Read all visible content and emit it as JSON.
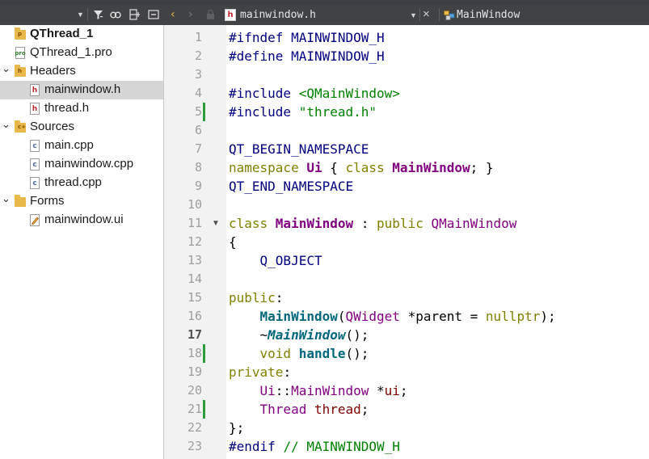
{
  "editor": {
    "file_badge": "h",
    "filename": "mainwindow.h",
    "symbol": "MainWindow",
    "nav_back": "‹",
    "nav_forward": "›",
    "close_glyph": "×",
    "lines": [
      {
        "n": "1",
        "mod": false,
        "fold": false,
        "tokens": [
          [
            "pp",
            "#ifndef MAINWINDOW_H"
          ]
        ]
      },
      {
        "n": "2",
        "mod": false,
        "fold": false,
        "tokens": [
          [
            "pp",
            "#define MAINWINDOW_H"
          ]
        ]
      },
      {
        "n": "3",
        "mod": false,
        "fold": false,
        "tokens": []
      },
      {
        "n": "4",
        "mod": false,
        "fold": false,
        "tokens": [
          [
            "pp",
            "#include "
          ],
          [
            "str",
            "<QMainWindow>"
          ]
        ]
      },
      {
        "n": "5",
        "mod": true,
        "fold": false,
        "tokens": [
          [
            "pp",
            "#include "
          ],
          [
            "str",
            "\"thread.h\""
          ]
        ]
      },
      {
        "n": "6",
        "mod": false,
        "fold": false,
        "tokens": []
      },
      {
        "n": "7",
        "mod": false,
        "fold": false,
        "tokens": [
          [
            "mac",
            "QT_BEGIN_NAMESPACE"
          ]
        ]
      },
      {
        "n": "8",
        "mod": false,
        "fold": false,
        "tokens": [
          [
            "kw",
            "namespace "
          ],
          [
            "ty",
            "Ui"
          ],
          [
            "",
            " { "
          ],
          [
            "kw",
            "class "
          ],
          [
            "ty",
            "MainWindow"
          ],
          [
            "",
            "; }"
          ]
        ]
      },
      {
        "n": "9",
        "mod": false,
        "fold": false,
        "tokens": [
          [
            "mac",
            "QT_END_NAMESPACE"
          ]
        ]
      },
      {
        "n": "10",
        "mod": false,
        "fold": false,
        "tokens": []
      },
      {
        "n": "11",
        "mod": false,
        "fold": true,
        "tokens": [
          [
            "kw",
            "class "
          ],
          [
            "ty",
            "MainWindow"
          ],
          [
            "",
            " : "
          ],
          [
            "kw",
            "public "
          ],
          [
            "ty2",
            "QMainWindow"
          ]
        ]
      },
      {
        "n": "12",
        "mod": false,
        "fold": false,
        "tokens": [
          [
            "",
            "{"
          ]
        ]
      },
      {
        "n": "13",
        "mod": false,
        "fold": false,
        "tokens": [
          [
            "",
            "    "
          ],
          [
            "mac",
            "Q_OBJECT"
          ]
        ]
      },
      {
        "n": "14",
        "mod": false,
        "fold": false,
        "tokens": []
      },
      {
        "n": "15",
        "mod": false,
        "fold": false,
        "tokens": [
          [
            "kw",
            "public"
          ],
          [
            "",
            ":"
          ]
        ]
      },
      {
        "n": "16",
        "mod": false,
        "fold": false,
        "tokens": [
          [
            "",
            "    "
          ],
          [
            "fn",
            "MainWindow"
          ],
          [
            "",
            "("
          ],
          [
            "ty2",
            "QWidget"
          ],
          [
            "",
            " *parent = "
          ],
          [
            "kw",
            "nullptr"
          ],
          [
            "",
            ");"
          ]
        ]
      },
      {
        "n": "17",
        "mod": false,
        "fold": false,
        "cur": true,
        "tokens": [
          [
            "",
            "    ~"
          ],
          [
            "fni",
            "MainWindow"
          ],
          [
            "",
            "();"
          ]
        ]
      },
      {
        "n": "18",
        "mod": true,
        "fold": false,
        "tokens": [
          [
            "",
            "    "
          ],
          [
            "kw",
            "void "
          ],
          [
            "fn",
            "handle"
          ],
          [
            "",
            "();"
          ]
        ]
      },
      {
        "n": "19",
        "mod": false,
        "fold": false,
        "tokens": [
          [
            "kw",
            "private"
          ],
          [
            "",
            ":"
          ]
        ]
      },
      {
        "n": "20",
        "mod": false,
        "fold": false,
        "tokens": [
          [
            "",
            "    "
          ],
          [
            "ty2",
            "Ui"
          ],
          [
            "",
            "::"
          ],
          [
            "ty2",
            "MainWindow"
          ],
          [
            "",
            " *"
          ],
          [
            "mem",
            "ui"
          ],
          [
            "",
            ";"
          ]
        ]
      },
      {
        "n": "21",
        "mod": true,
        "fold": false,
        "tokens": [
          [
            "",
            "    "
          ],
          [
            "ty2",
            "Thread "
          ],
          [
            "mem",
            "thread"
          ],
          [
            "",
            ";"
          ]
        ]
      },
      {
        "n": "22",
        "mod": false,
        "fold": false,
        "tokens": [
          [
            "",
            "};"
          ]
        ]
      },
      {
        "n": "23",
        "mod": false,
        "fold": false,
        "tokens": [
          [
            "pp",
            "#endif "
          ],
          [
            "cm",
            "// MAINWINDOW_H"
          ]
        ]
      }
    ]
  },
  "tree": [
    {
      "name": "project-root",
      "label": "QThread_1",
      "depth": 0,
      "arrow": "",
      "icon": "folder",
      "tag": "pro",
      "bold": true,
      "selected": false
    },
    {
      "name": "file-qthread-pro",
      "label": "QThread_1.pro",
      "depth": 1,
      "arrow": "",
      "icon": "pro",
      "tag": "",
      "bold": false,
      "selected": false
    },
    {
      "name": "folder-headers",
      "label": "Headers",
      "depth": 0,
      "arrow": "v",
      "icon": "folder",
      "tag": "h",
      "bold": false,
      "selected": false
    },
    {
      "name": "file-mainwindow-h",
      "label": "mainwindow.h",
      "depth": 2,
      "arrow": "",
      "icon": "h",
      "tag": "",
      "bold": false,
      "selected": true
    },
    {
      "name": "file-thread-h",
      "label": "thread.h",
      "depth": 2,
      "arrow": "",
      "icon": "h",
      "tag": "",
      "bold": false,
      "selected": false
    },
    {
      "name": "folder-sources",
      "label": "Sources",
      "depth": 0,
      "arrow": "v",
      "icon": "folder",
      "tag": "c++",
      "bold": false,
      "selected": false
    },
    {
      "name": "file-main-cpp",
      "label": "main.cpp",
      "depth": 2,
      "arrow": "",
      "icon": "c",
      "tag": "",
      "bold": false,
      "selected": false
    },
    {
      "name": "file-mainwindow-cpp",
      "label": "mainwindow.cpp",
      "depth": 2,
      "arrow": "",
      "icon": "c",
      "tag": "",
      "bold": false,
      "selected": false
    },
    {
      "name": "file-thread-cpp",
      "label": "thread.cpp",
      "depth": 2,
      "arrow": "",
      "icon": "c",
      "tag": "",
      "bold": false,
      "selected": false
    },
    {
      "name": "folder-forms",
      "label": "Forms",
      "depth": 0,
      "arrow": "v",
      "icon": "folder",
      "tag": "",
      "bold": false,
      "selected": false
    },
    {
      "name": "file-mainwindow-ui",
      "label": "mainwindow.ui",
      "depth": 2,
      "arrow": "",
      "icon": "ui",
      "tag": "",
      "bold": false,
      "selected": false
    }
  ],
  "colors": {
    "toolbar_bg": "#404244",
    "gutter_bg": "#f2f2f2",
    "modified_marker": "#2e9b3a",
    "nav_back": "#e8b84a",
    "nav_forward": "#7a7a7a",
    "tree_selection": "#d6d6d6"
  },
  "icons": {
    "filter": "filter-icon",
    "link": "link-icon",
    "split": "split-icon",
    "collapse": "collapse-icon",
    "lock": "lock-icon",
    "symbol": "class-symbol-icon"
  }
}
